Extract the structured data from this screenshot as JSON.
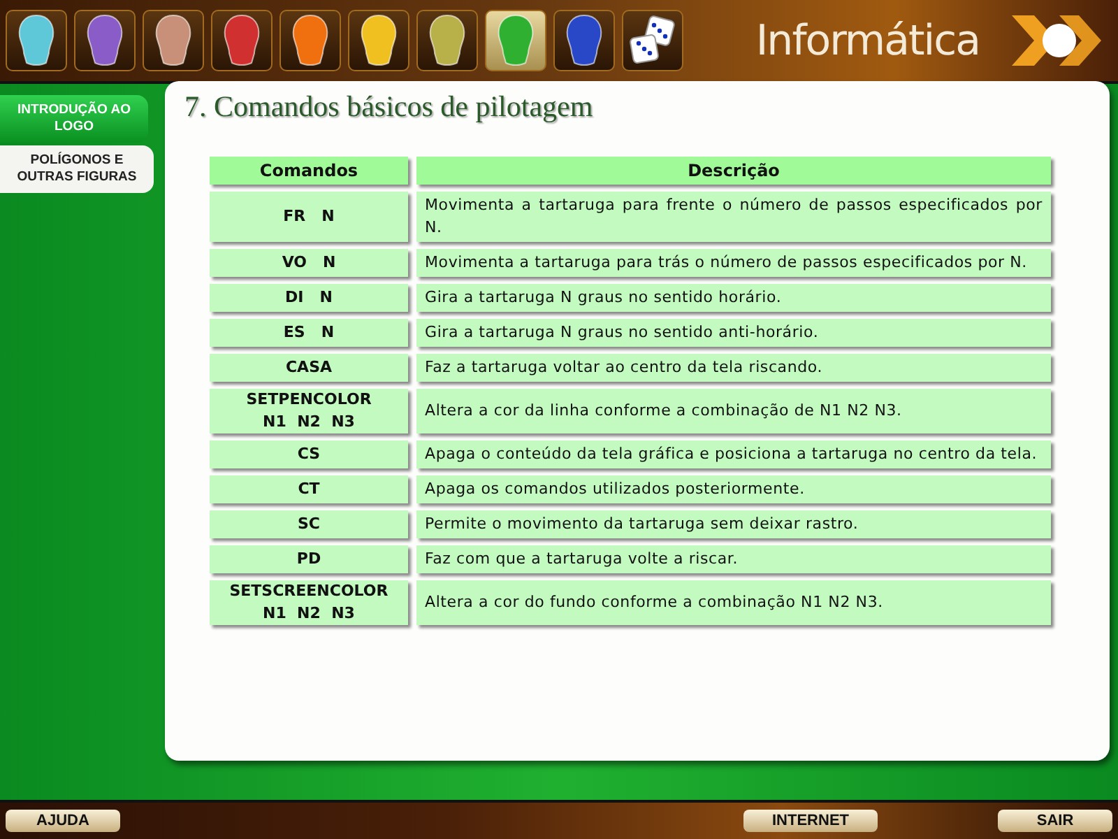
{
  "toolbar": {
    "items": [
      {
        "kind": "head",
        "color": "#5fc8d8",
        "selected": false
      },
      {
        "kind": "head",
        "color": "#8a5cc8",
        "selected": false
      },
      {
        "kind": "head",
        "color": "#c89078",
        "selected": false
      },
      {
        "kind": "head",
        "color": "#d03030",
        "selected": false
      },
      {
        "kind": "head",
        "color": "#f07010",
        "selected": false
      },
      {
        "kind": "head",
        "color": "#f0c020",
        "selected": false
      },
      {
        "kind": "head",
        "color": "#b8b048",
        "selected": false
      },
      {
        "kind": "head",
        "color": "#30b030",
        "selected": true
      },
      {
        "kind": "head",
        "color": "#2848c8",
        "selected": false
      },
      {
        "kind": "dice",
        "selected": false
      }
    ],
    "brand": "Informática"
  },
  "sidebar": {
    "items": [
      {
        "label": "INTRODUÇÃO AO LOGO",
        "selected": false
      },
      {
        "label": "POLÍGONOS E OUTRAS FIGURAS",
        "selected": true
      }
    ]
  },
  "page": {
    "title": "7. Comandos básicos de pilotagem"
  },
  "table": {
    "columns": [
      "Comandos",
      "Descrição"
    ],
    "rows": [
      {
        "command": "FR   N",
        "description": "Movimenta a tartaruga para frente o número de passos especificados por N."
      },
      {
        "command": "VO   N",
        "description": "Movimenta a tartaruga para trás o número de passos especificados por N."
      },
      {
        "command": "DI   N",
        "description": "Gira a tartaruga N graus no sentido horário."
      },
      {
        "command": "ES   N",
        "description": "Gira a tartaruga N graus no sentido anti-horário."
      },
      {
        "command": "CASA",
        "description": "Faz a tartaruga voltar ao centro da tela riscando."
      },
      {
        "command": "SETPENCOLOR\nN1  N2  N3",
        "description": "Altera a cor da linha conforme a combinação de N1 N2 N3."
      },
      {
        "command": "CS",
        "description": "Apaga o conteúdo da tela gráfica e posiciona a tartaruga no centro da tela."
      },
      {
        "command": "CT",
        "description": "Apaga os comandos utilizados posteriormente."
      },
      {
        "command": "SC",
        "description": "Permite o movimento da tartaruga sem deixar rastro."
      },
      {
        "command": "PD",
        "description": "Faz com que a tartaruga volte a riscar."
      },
      {
        "command": "SETSCREENCOLOR\nN1  N2  N3",
        "description": "Altera a cor do fundo conforme a combinação N1  N2  N3."
      }
    ]
  },
  "footer": {
    "buttons": [
      "AJUDA",
      "INTERNET",
      "SAIR"
    ]
  }
}
